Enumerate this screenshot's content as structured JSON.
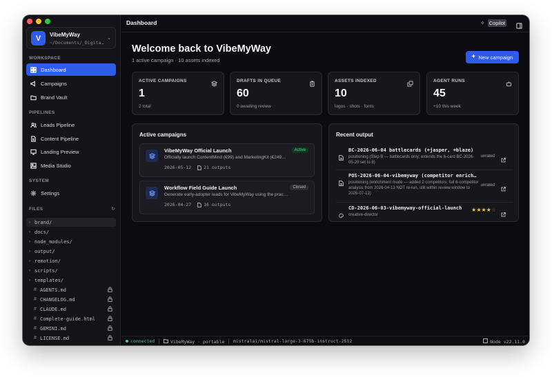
{
  "workspace": {
    "avatar_letter": "V",
    "name": "VibeMyWay",
    "path": "~/Documents/_Digita…"
  },
  "sidebar": {
    "sections": {
      "workspace": "WORKSPACE",
      "pipelines": "PIPELINES",
      "system": "SYSTEM",
      "files": "FILES"
    },
    "workspace_items": [
      {
        "label": "Dashboard",
        "icon": "dashboard-icon",
        "active": true
      },
      {
        "label": "Campaigns",
        "icon": "megaphone-icon"
      },
      {
        "label": "Brand Vault",
        "icon": "folder-icon"
      }
    ],
    "pipeline_items": [
      {
        "label": "Leads Pipeline",
        "icon": "users-icon"
      },
      {
        "label": "Content Pipeline",
        "icon": "file-text-icon"
      },
      {
        "label": "Landing Preview",
        "icon": "monitor-icon"
      },
      {
        "label": "Media Studio",
        "icon": "image-icon"
      }
    ],
    "system_items": [
      {
        "label": "Settings",
        "icon": "gear-icon"
      }
    ],
    "files": [
      {
        "name": "brand/",
        "type": "folder",
        "selected": true
      },
      {
        "name": "docs/",
        "type": "folder"
      },
      {
        "name": "node_modules/",
        "type": "folder"
      },
      {
        "name": "output/",
        "type": "folder"
      },
      {
        "name": "remotion/",
        "type": "folder"
      },
      {
        "name": "scripts/",
        "type": "folder"
      },
      {
        "name": "templates/",
        "type": "folder"
      },
      {
        "name": "AGENTS.md",
        "type": "file",
        "locked": true
      },
      {
        "name": "CHANGELOG.md",
        "type": "file",
        "locked": true
      },
      {
        "name": "CLAUDE.md",
        "type": "file",
        "locked": true
      },
      {
        "name": "Complete-guide.html",
        "type": "file",
        "locked": true
      },
      {
        "name": "GEMINI.md",
        "type": "file",
        "locked": true
      },
      {
        "name": "LICENSE.md",
        "type": "file",
        "locked": true
      }
    ]
  },
  "topbar": {
    "title": "Dashboard",
    "copilot_label": "Copilot"
  },
  "main": {
    "welcome": "Welcome back to VibeMyWay",
    "subtitle": "1 active campaign · 10 assets indexed",
    "new_button": "New campaign",
    "stats": [
      {
        "label": "ACTIVE CAMPAIGNS",
        "value": "1",
        "sub": "2 total",
        "icon": "layers-icon"
      },
      {
        "label": "DRAFTS IN QUEUE",
        "value": "60",
        "sub": "0 awaiting review",
        "icon": "clipboard-icon"
      },
      {
        "label": "ASSETS INDEXED",
        "value": "10",
        "sub": "logos · shots · fonts",
        "icon": "copy-icon"
      },
      {
        "label": "AGENT RUNS",
        "value": "45",
        "sub": "+10 this week",
        "icon": "bot-icon"
      }
    ],
    "active_campaigns": {
      "title": "Active campaigns",
      "items": [
        {
          "name": "VibeMyWay Official Launch",
          "status": "Active",
          "description": "Officially launch ContentMind (€99) and MarketingKit (€249…",
          "date": "2026-05-12",
          "outputs": "21 outputs"
        },
        {
          "name": "Workflow Field Guide Launch",
          "status": "Closed",
          "description": "Generate early-adopter leads for VibeMyWay using the prac…",
          "date": "2026-04-27",
          "outputs": "16 outputs"
        }
      ]
    },
    "recent_output": {
      "title": "Recent output",
      "items": [
        {
          "title": "BC-2026-06-04 battlecards (+jasper, +blaze)",
          "desc": "positioning (Step B — battlecards only; extends the 6-card BC-2026-05-20 set to 8)",
          "status": "unrated"
        },
        {
          "title": "POS-2026-06-04-vibemyway (competitor enrich…",
          "desc": "positioning (enrichment mode — added 2 competitors; full 6-competitor analysis from 2026-04-13 NOT re-run, still within review window to 2026-07-13)",
          "status": "unrated"
        },
        {
          "title": "CD-2026-06-03-vibemyway-official-launch",
          "desc": "creative-director",
          "rating": 4,
          "rating_max": 5
        }
      ]
    }
  },
  "statusbar": {
    "connection": "connected",
    "project": "VibeMyWay · portable",
    "model": "mistralai/mistral-large-3-675b-instruct-2512",
    "node": "Node v22.11.0"
  },
  "colors": {
    "accent": "#2f5bea",
    "success": "#3ecf8e",
    "star": "#f5c342",
    "background": "#0c0c10"
  }
}
